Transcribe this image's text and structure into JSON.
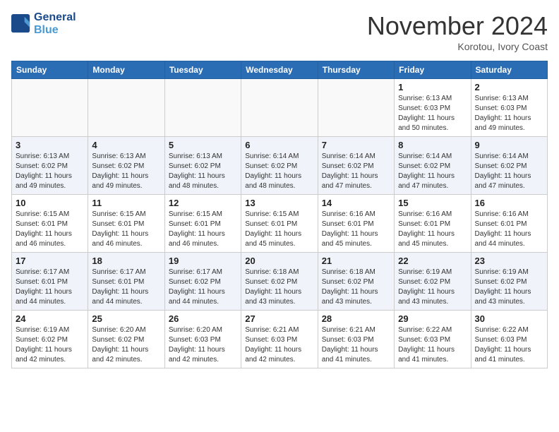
{
  "header": {
    "logo_line1": "General",
    "logo_line2": "Blue",
    "month": "November 2024",
    "location": "Korotou, Ivory Coast"
  },
  "days_of_week": [
    "Sunday",
    "Monday",
    "Tuesday",
    "Wednesday",
    "Thursday",
    "Friday",
    "Saturday"
  ],
  "weeks": [
    [
      {
        "day": "",
        "info": ""
      },
      {
        "day": "",
        "info": ""
      },
      {
        "day": "",
        "info": ""
      },
      {
        "day": "",
        "info": ""
      },
      {
        "day": "",
        "info": ""
      },
      {
        "day": "1",
        "info": "Sunrise: 6:13 AM\nSunset: 6:03 PM\nDaylight: 11 hours\nand 50 minutes."
      },
      {
        "day": "2",
        "info": "Sunrise: 6:13 AM\nSunset: 6:03 PM\nDaylight: 11 hours\nand 49 minutes."
      }
    ],
    [
      {
        "day": "3",
        "info": "Sunrise: 6:13 AM\nSunset: 6:02 PM\nDaylight: 11 hours\nand 49 minutes."
      },
      {
        "day": "4",
        "info": "Sunrise: 6:13 AM\nSunset: 6:02 PM\nDaylight: 11 hours\nand 49 minutes."
      },
      {
        "day": "5",
        "info": "Sunrise: 6:13 AM\nSunset: 6:02 PM\nDaylight: 11 hours\nand 48 minutes."
      },
      {
        "day": "6",
        "info": "Sunrise: 6:14 AM\nSunset: 6:02 PM\nDaylight: 11 hours\nand 48 minutes."
      },
      {
        "day": "7",
        "info": "Sunrise: 6:14 AM\nSunset: 6:02 PM\nDaylight: 11 hours\nand 47 minutes."
      },
      {
        "day": "8",
        "info": "Sunrise: 6:14 AM\nSunset: 6:02 PM\nDaylight: 11 hours\nand 47 minutes."
      },
      {
        "day": "9",
        "info": "Sunrise: 6:14 AM\nSunset: 6:02 PM\nDaylight: 11 hours\nand 47 minutes."
      }
    ],
    [
      {
        "day": "10",
        "info": "Sunrise: 6:15 AM\nSunset: 6:01 PM\nDaylight: 11 hours\nand 46 minutes."
      },
      {
        "day": "11",
        "info": "Sunrise: 6:15 AM\nSunset: 6:01 PM\nDaylight: 11 hours\nand 46 minutes."
      },
      {
        "day": "12",
        "info": "Sunrise: 6:15 AM\nSunset: 6:01 PM\nDaylight: 11 hours\nand 46 minutes."
      },
      {
        "day": "13",
        "info": "Sunrise: 6:15 AM\nSunset: 6:01 PM\nDaylight: 11 hours\nand 45 minutes."
      },
      {
        "day": "14",
        "info": "Sunrise: 6:16 AM\nSunset: 6:01 PM\nDaylight: 11 hours\nand 45 minutes."
      },
      {
        "day": "15",
        "info": "Sunrise: 6:16 AM\nSunset: 6:01 PM\nDaylight: 11 hours\nand 45 minutes."
      },
      {
        "day": "16",
        "info": "Sunrise: 6:16 AM\nSunset: 6:01 PM\nDaylight: 11 hours\nand 44 minutes."
      }
    ],
    [
      {
        "day": "17",
        "info": "Sunrise: 6:17 AM\nSunset: 6:01 PM\nDaylight: 11 hours\nand 44 minutes."
      },
      {
        "day": "18",
        "info": "Sunrise: 6:17 AM\nSunset: 6:01 PM\nDaylight: 11 hours\nand 44 minutes."
      },
      {
        "day": "19",
        "info": "Sunrise: 6:17 AM\nSunset: 6:02 PM\nDaylight: 11 hours\nand 44 minutes."
      },
      {
        "day": "20",
        "info": "Sunrise: 6:18 AM\nSunset: 6:02 PM\nDaylight: 11 hours\nand 43 minutes."
      },
      {
        "day": "21",
        "info": "Sunrise: 6:18 AM\nSunset: 6:02 PM\nDaylight: 11 hours\nand 43 minutes."
      },
      {
        "day": "22",
        "info": "Sunrise: 6:19 AM\nSunset: 6:02 PM\nDaylight: 11 hours\nand 43 minutes."
      },
      {
        "day": "23",
        "info": "Sunrise: 6:19 AM\nSunset: 6:02 PM\nDaylight: 11 hours\nand 43 minutes."
      }
    ],
    [
      {
        "day": "24",
        "info": "Sunrise: 6:19 AM\nSunset: 6:02 PM\nDaylight: 11 hours\nand 42 minutes."
      },
      {
        "day": "25",
        "info": "Sunrise: 6:20 AM\nSunset: 6:02 PM\nDaylight: 11 hours\nand 42 minutes."
      },
      {
        "day": "26",
        "info": "Sunrise: 6:20 AM\nSunset: 6:03 PM\nDaylight: 11 hours\nand 42 minutes."
      },
      {
        "day": "27",
        "info": "Sunrise: 6:21 AM\nSunset: 6:03 PM\nDaylight: 11 hours\nand 42 minutes."
      },
      {
        "day": "28",
        "info": "Sunrise: 6:21 AM\nSunset: 6:03 PM\nDaylight: 11 hours\nand 41 minutes."
      },
      {
        "day": "29",
        "info": "Sunrise: 6:22 AM\nSunset: 6:03 PM\nDaylight: 11 hours\nand 41 minutes."
      },
      {
        "day": "30",
        "info": "Sunrise: 6:22 AM\nSunset: 6:03 PM\nDaylight: 11 hours\nand 41 minutes."
      }
    ]
  ]
}
